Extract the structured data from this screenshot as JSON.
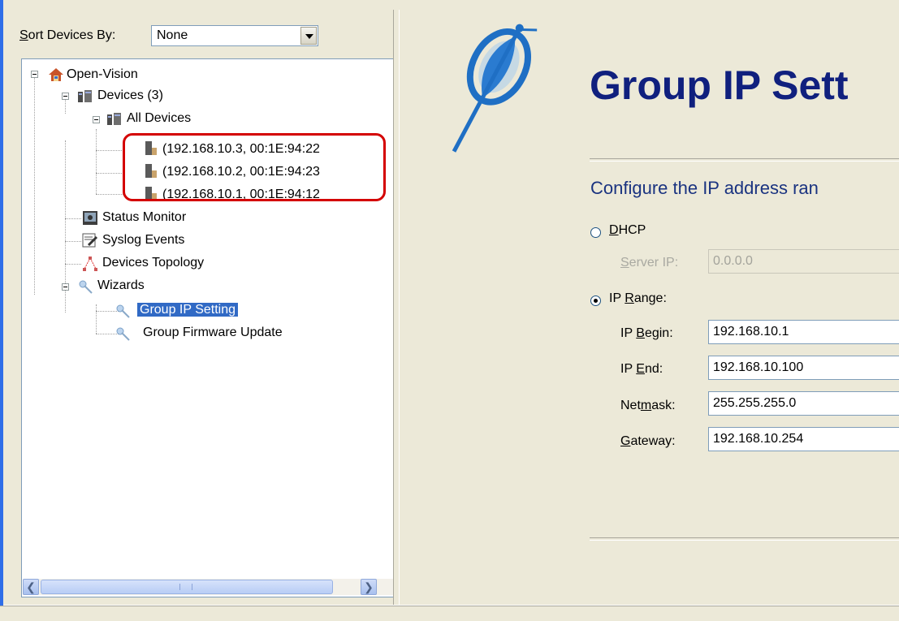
{
  "sort": {
    "label_prefix": "S",
    "label_rest": "ort Devices By:",
    "value": "None"
  },
  "tree": {
    "root": "Open-Vision",
    "devices": "Devices (3)",
    "all_devices": "All Devices",
    "device_items": [
      "(192.168.10.3, 00:1E:94:22",
      "(192.168.10.2, 00:1E:94:23",
      "(192.168.10.1, 00:1E:94:12"
    ],
    "status_monitor": "Status Monitor",
    "syslog_events": "Syslog Events",
    "devices_topology": "Devices Topology",
    "wizards": "Wizards",
    "group_ip_setting": "Group IP Setting",
    "group_firmware_update": "Group Firmware Update"
  },
  "main": {
    "title": "Group IP Sett",
    "subtitle": "Configure the IP address ran",
    "dhcp": {
      "mnemonic": "D",
      "rest": "HCP",
      "selected": false
    },
    "server_ip": {
      "label_prefix": "S",
      "label_rest": "erver IP:",
      "value": "0.0.0.0",
      "enabled": false
    },
    "ip_range": {
      "before": "IP ",
      "mnemonic": "R",
      "rest": "ange:",
      "selected": true
    },
    "fields": [
      {
        "before": "IP ",
        "mnemonic": "B",
        "after": "egin:",
        "value": "192.168.10.1"
      },
      {
        "before": "IP ",
        "mnemonic": "E",
        "after": "nd:",
        "value": "192.168.10.100"
      },
      {
        "before": "Net",
        "mnemonic": "m",
        "after": "ask:",
        "value": "255.255.255.0"
      },
      {
        "before": "",
        "mnemonic": "G",
        "after": "ateway:",
        "value": "192.168.10.254"
      }
    ]
  },
  "icons": {
    "home": "home-icon",
    "devices": "switch-icon",
    "device": "device-icon",
    "monitor": "monitor-icon",
    "syslog": "syslog-icon",
    "topology": "topology-icon",
    "wizard": "wizard-icon",
    "logo": "satellite-wand-logo"
  },
  "colors": {
    "title": "#10207e",
    "subtitle": "#1a3380",
    "selection": "#316ac5",
    "highlight": "#d40000"
  }
}
